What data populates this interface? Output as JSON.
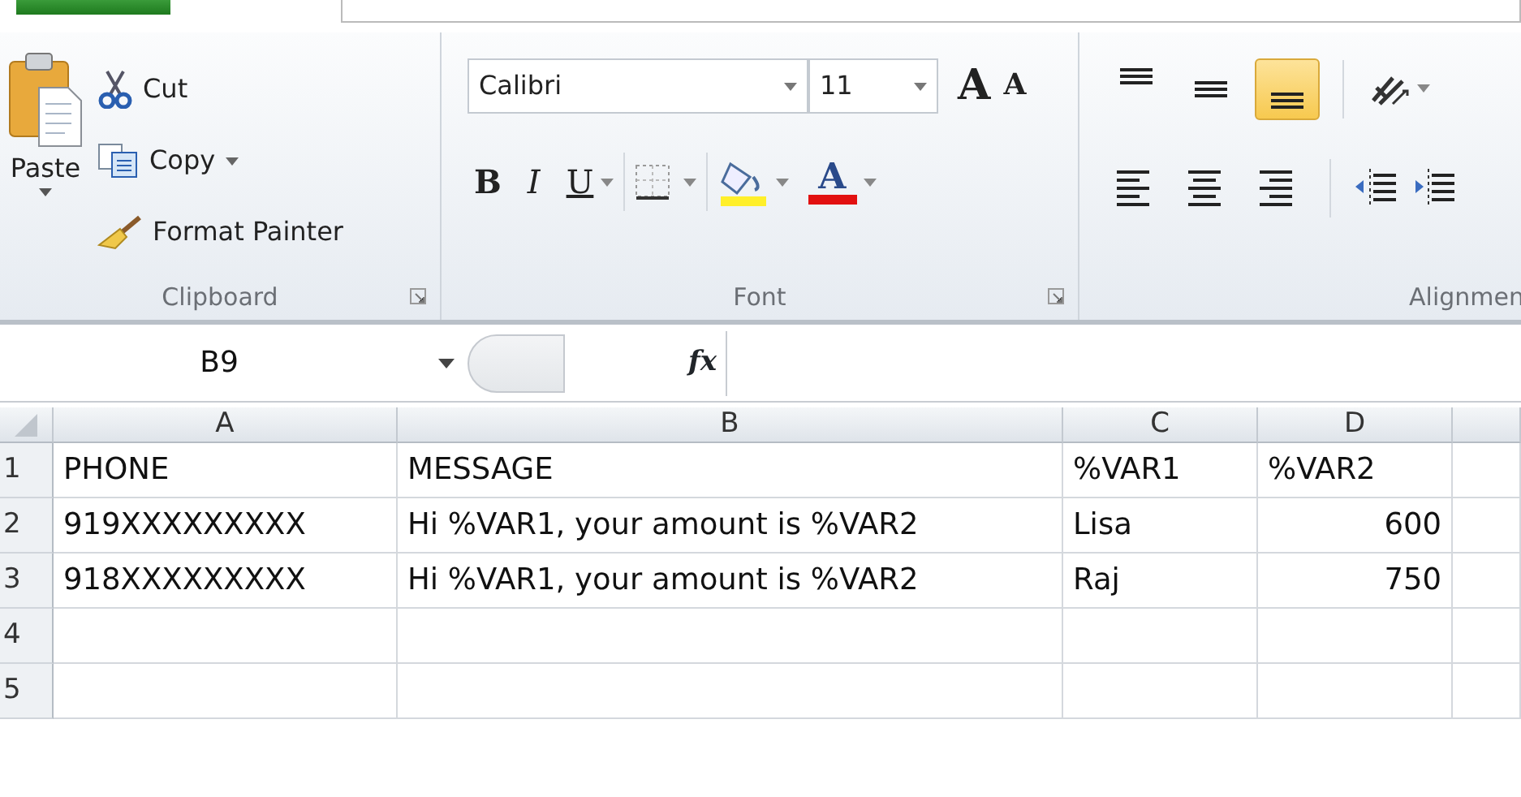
{
  "ribbon": {
    "clipboard": {
      "paste": "Paste",
      "cut": "Cut",
      "copy": "Copy",
      "format_painter": "Format Painter",
      "label": "Clipboard"
    },
    "font": {
      "font_name": "Calibri",
      "font_size": "11",
      "grow": "A",
      "shrink": "A",
      "bold": "B",
      "italic": "I",
      "underline": "U",
      "font_color": "A",
      "label": "Font"
    },
    "alignment": {
      "vertical": [
        {
          "kind": "top",
          "selected": false
        },
        {
          "kind": "middle",
          "selected": false
        },
        {
          "kind": "bottom",
          "selected": true
        }
      ],
      "horizontal": [
        {
          "kind": "left"
        },
        {
          "kind": "center"
        },
        {
          "kind": "right"
        }
      ],
      "label": "Alignmen"
    }
  },
  "formula_bar": {
    "name_box": "B9",
    "fx": "fx"
  },
  "sheet": {
    "columns": [
      "A",
      "B",
      "C",
      "D"
    ],
    "rows": [
      {
        "header": "1",
        "cells": [
          "PHONE",
          "MESSAGE",
          "%VAR1",
          "%VAR2"
        ]
      },
      {
        "header": "2",
        "cells": [
          "919XXXXXXXXX",
          "Hi %VAR1, your amount is %VAR2",
          "Lisa",
          "600"
        ]
      },
      {
        "header": "3",
        "cells": [
          "918XXXXXXXXX",
          "Hi %VAR1, your amount is %VAR2",
          "Raj",
          "750"
        ]
      },
      {
        "header": "4",
        "cells": []
      },
      {
        "header": "5",
        "cells": []
      }
    ]
  }
}
